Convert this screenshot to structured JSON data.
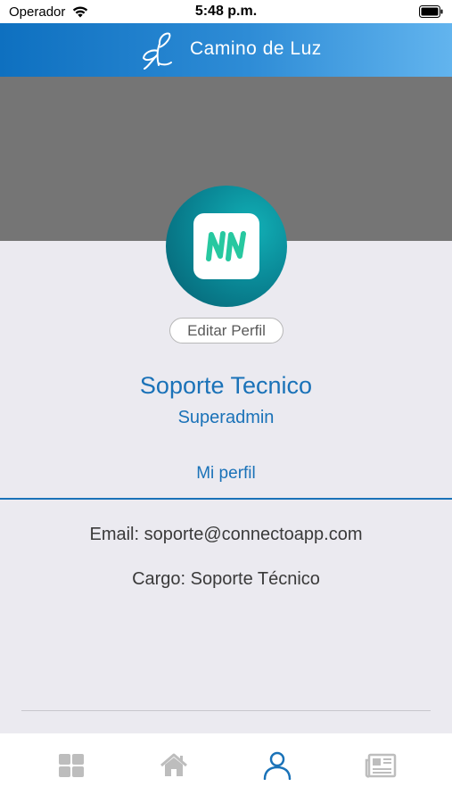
{
  "status_bar": {
    "carrier": "Operador",
    "time": "5:48 p.m.",
    "icons": [
      "wifi-icon",
      "battery-icon"
    ]
  },
  "header": {
    "brand": "Camino de Luz",
    "logo_icon": "butterfly-icon"
  },
  "profile": {
    "avatar_icon": "app-logo-nn",
    "edit_label": "Editar Perfil",
    "name": "Soporte Tecnico",
    "role": "Superadmin"
  },
  "tabs": {
    "active_label": "Mi perfil"
  },
  "info": {
    "email": "Email: soporte@connectoapp.com",
    "cargo": "Cargo: Soporte Técnico"
  },
  "tabbar": {
    "items": [
      {
        "icon": "grid-icon",
        "active": false
      },
      {
        "icon": "home-icon",
        "active": false
      },
      {
        "icon": "user-icon",
        "active": true
      },
      {
        "icon": "news-icon",
        "active": false
      }
    ]
  },
  "colors": {
    "accent": "#1A72B8",
    "header_start": "#0E70C0",
    "header_end": "#62B4EE",
    "cover": "#757575",
    "background": "#EBEAF0",
    "inactive_icon": "#BDBDBD"
  }
}
